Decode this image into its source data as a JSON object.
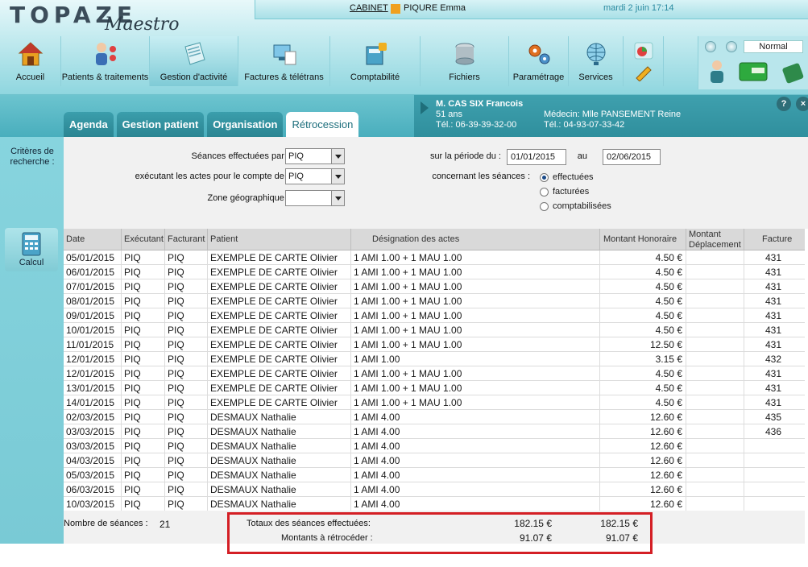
{
  "app": {
    "logo_main": "TOPAZE",
    "logo_sub": "Maestro"
  },
  "infobar": {
    "cabinet_label": "CABINET",
    "user_name": "PIQURE Emma",
    "datetime": "mardi 2 juin 17:14"
  },
  "nav": [
    {
      "label": "Accueil",
      "icon": "house-icon"
    },
    {
      "label": "Patients & traitements",
      "icon": "patients-icon"
    },
    {
      "label": "Gestion d'activité",
      "icon": "document-icon",
      "active": true
    },
    {
      "label": "Factures & télétrans",
      "icon": "monitor-icon"
    },
    {
      "label": "Comptabilité",
      "icon": "calculator-lock-icon"
    },
    {
      "label": "Fichiers",
      "icon": "database-icon"
    },
    {
      "label": "Paramétrage",
      "icon": "gears-icon"
    },
    {
      "label": "Services",
      "icon": "globe-icon"
    }
  ],
  "tools": {
    "mode_value": "Normal"
  },
  "patient": {
    "name": "M. CAS SIX Francois",
    "age": "51 ans",
    "tel": "Tél.: 06-39-39-32-00",
    "doctor": "Médecin: Mlle PANSEMENT Reine",
    "doctor_tel": "Tél.: 04-93-07-33-42"
  },
  "tabs": [
    "Agenda",
    "Gestion patient",
    "Organisation",
    "Rétrocession"
  ],
  "sidebar": {
    "criteria_label": "Critères de recherche :",
    "calc_label": "Calcul"
  },
  "criteria": {
    "seances_label": "Séances effectuées par :",
    "seances_value": "PIQ",
    "compte_label": "exécutant les actes pour le compte de :",
    "compte_value": "PIQ",
    "zone_label": "Zone géographique :",
    "zone_value": "",
    "periode_label": "sur la période du :",
    "date_from": "01/01/2015",
    "au_label": "au",
    "date_to": "02/06/2015",
    "concernant_label": "concernant les séances :",
    "radios": [
      {
        "label": "effectuées",
        "checked": true
      },
      {
        "label": "facturées",
        "checked": false
      },
      {
        "label": "comptabilisées",
        "checked": false
      }
    ]
  },
  "table": {
    "headers": [
      "Date",
      "Exécutant",
      "Facturant",
      "Patient",
      "Désignation des actes",
      "Montant Honoraire",
      "Montant Déplacement",
      "Facture"
    ],
    "rows": [
      [
        "05/01/2015",
        "PIQ",
        "PIQ",
        "EXEMPLE DE CARTE Olivier",
        "1 AMI 1.00 + 1 MAU 1.00",
        "4.50 €",
        "",
        "431"
      ],
      [
        "06/01/2015",
        "PIQ",
        "PIQ",
        "EXEMPLE DE CARTE Olivier",
        "1 AMI 1.00 + 1 MAU 1.00",
        "4.50 €",
        "",
        "431"
      ],
      [
        "07/01/2015",
        "PIQ",
        "PIQ",
        "EXEMPLE DE CARTE Olivier",
        "1 AMI 1.00 + 1 MAU 1.00",
        "4.50 €",
        "",
        "431"
      ],
      [
        "08/01/2015",
        "PIQ",
        "PIQ",
        "EXEMPLE DE CARTE Olivier",
        "1 AMI 1.00 + 1 MAU 1.00",
        "4.50 €",
        "",
        "431"
      ],
      [
        "09/01/2015",
        "PIQ",
        "PIQ",
        "EXEMPLE DE CARTE Olivier",
        "1 AMI 1.00 + 1 MAU 1.00",
        "4.50 €",
        "",
        "431"
      ],
      [
        "10/01/2015",
        "PIQ",
        "PIQ",
        "EXEMPLE DE CARTE Olivier",
        "1 AMI 1.00 + 1 MAU 1.00",
        "4.50 €",
        "",
        "431"
      ],
      [
        "11/01/2015",
        "PIQ",
        "PIQ",
        "EXEMPLE DE CARTE Olivier",
        "1 AMI 1.00 + 1 MAU 1.00",
        "12.50 €",
        "",
        "431"
      ],
      [
        "12/01/2015",
        "PIQ",
        "PIQ",
        "EXEMPLE DE CARTE Olivier",
        "1 AMI 1.00",
        "3.15 €",
        "",
        "432"
      ],
      [
        "12/01/2015",
        "PIQ",
        "PIQ",
        "EXEMPLE DE CARTE Olivier",
        "1 AMI 1.00 + 1 MAU 1.00",
        "4.50 €",
        "",
        "431"
      ],
      [
        "13/01/2015",
        "PIQ",
        "PIQ",
        "EXEMPLE DE CARTE Olivier",
        "1 AMI 1.00 + 1 MAU 1.00",
        "4.50 €",
        "",
        "431"
      ],
      [
        "14/01/2015",
        "PIQ",
        "PIQ",
        "EXEMPLE DE CARTE Olivier",
        "1 AMI 1.00 + 1 MAU 1.00",
        "4.50 €",
        "",
        "431"
      ],
      [
        "02/03/2015",
        "PIQ",
        "PIQ",
        "DESMAUX Nathalie",
        "1 AMI 4.00",
        "12.60 €",
        "",
        "435"
      ],
      [
        "03/03/2015",
        "PIQ",
        "PIQ",
        "DESMAUX Nathalie",
        "1 AMI 4.00",
        "12.60 €",
        "",
        "436"
      ],
      [
        "03/03/2015",
        "PIQ",
        "PIQ",
        "DESMAUX Nathalie",
        "1 AMI 4.00",
        "12.60 €",
        "",
        ""
      ],
      [
        "04/03/2015",
        "PIQ",
        "PIQ",
        "DESMAUX Nathalie",
        "1 AMI 4.00",
        "12.60 €",
        "",
        ""
      ],
      [
        "05/03/2015",
        "PIQ",
        "PIQ",
        "DESMAUX Nathalie",
        "1 AMI 4.00",
        "12.60 €",
        "",
        ""
      ],
      [
        "06/03/2015",
        "PIQ",
        "PIQ",
        "DESMAUX Nathalie",
        "1 AMI 4.00",
        "12.60 €",
        "",
        ""
      ],
      [
        "10/03/2015",
        "PIQ",
        "PIQ",
        "DESMAUX Nathalie",
        "1 AMI 4.00",
        "12.60 €",
        "",
        ""
      ]
    ]
  },
  "footer": {
    "count_label": "Nombre de séances :",
    "count_value": "21",
    "totaux_label": "Totaux des séances effectuées:",
    "totaux_1": "182.15 €",
    "totaux_2": "182.15 €",
    "retro_label": "Montants à rétrocéder :",
    "retro_1": "91.07 €",
    "retro_2": "91.07 €"
  },
  "colors": {
    "accent": "#2b8592",
    "highlight": "#d41f25"
  }
}
